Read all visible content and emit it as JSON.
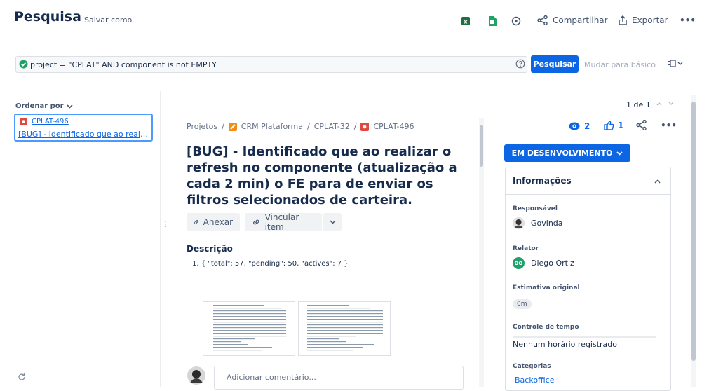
{
  "header": {
    "title": "Pesquisa",
    "save_as": "Salvar como",
    "share_label": "Compartilhar",
    "export_label": "Exportar",
    "more_label": "•••"
  },
  "search": {
    "jql_parts": {
      "p1": "project = \"",
      "project": "CPLAT",
      "p2": "\" ",
      "and": "AND",
      "sp1": " ",
      "component": "component",
      "is": " is ",
      "not": "not",
      "sp2": " ",
      "empty": "EMPTY"
    },
    "search_button": "Pesquisar",
    "basic_link": "Mudar para básico"
  },
  "left_panel": {
    "order_by": "Ordenar por",
    "results": [
      {
        "key": "CPLAT-496",
        "summary": "[BUG] - Identificado que ao realizar o refresh no componente"
      }
    ]
  },
  "issue": {
    "breadcrumb": {
      "root": "Projetos",
      "project": "CRM Plataforma",
      "parent": "CPLAT-32",
      "key": "CPLAT-496",
      "sep": "/"
    },
    "title": "[BUG] - Identificado que ao realizar o refresh no componente (atualização a cada 2 min) o FE para de enviar os filtros selecionados de carteira.",
    "attach_label": "Anexar",
    "link_label": "Vincular item",
    "description_heading": "Descrição",
    "description_items": [
      "1. { \"total\": 57, \"pending\": 50, \"actives\": 7 }"
    ],
    "comment_placeholder": "Adicionar comentário..."
  },
  "right": {
    "paging": "1 de 1",
    "watchers": "2",
    "votes": "1",
    "status": "EM DESENVOLVIMENTO",
    "info": {
      "heading": "Informações",
      "assignee_label": "Responsável",
      "assignee": "Govinda",
      "reporter_label": "Relator",
      "reporter": "Diego Ortiz",
      "reporter_initials": "DO",
      "estimate_label": "Estimativa original",
      "estimate": "0m",
      "time_label": "Controle de tempo",
      "time_value": "Nenhum horário registrado",
      "categories_label": "Categorias",
      "category": "Backoffice"
    }
  },
  "colors": {
    "primary": "#0c66e4",
    "success": "#22a06b",
    "bug": "#e2483d",
    "project": "#f18d13"
  }
}
